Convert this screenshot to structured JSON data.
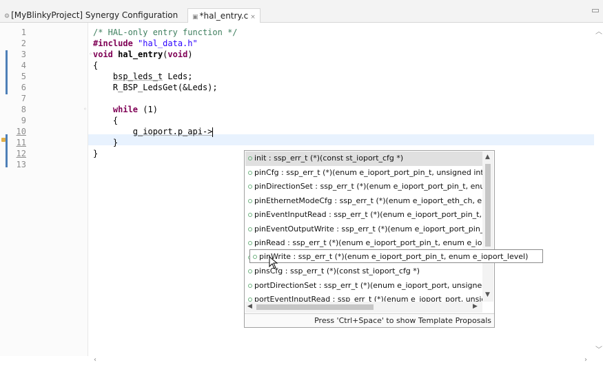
{
  "tabs": [
    {
      "label": "[MyBlinkyProject] Synergy Configuration",
      "icon": "gear-icon"
    },
    {
      "label": "*hal_entry.c",
      "icon": "c-file-icon",
      "close": "×"
    }
  ],
  "editor": {
    "line_numbers": [
      "1",
      "2",
      "3",
      "4",
      "5",
      "6",
      "7",
      "8",
      "9",
      "10",
      "11",
      "12",
      "13"
    ],
    "lines": [
      {
        "parts": [
          {
            "t": "/* HAL-only entry function */",
            "c": "cmt"
          }
        ]
      },
      {
        "parts": [
          {
            "t": "#include",
            "c": "kw"
          },
          {
            "t": " "
          },
          {
            "t": "\"hal_data.h\"",
            "c": "str"
          }
        ]
      },
      {
        "parts": [
          {
            "t": "void",
            "c": "kw"
          },
          {
            "t": " "
          },
          {
            "t": "hal_entry",
            "c": "fn"
          },
          {
            "t": "("
          },
          {
            "t": "void",
            "c": "kw"
          },
          {
            "t": ")"
          }
        ]
      },
      {
        "parts": [
          {
            "t": "{"
          }
        ]
      },
      {
        "parts": [
          {
            "t": "    "
          },
          {
            "t": "bsp_leds_t",
            "c": "ident"
          },
          {
            "t": " Leds;"
          }
        ]
      },
      {
        "parts": [
          {
            "t": "    R_BSP_LedsGet(&Leds);"
          }
        ]
      },
      {
        "parts": []
      },
      {
        "parts": [
          {
            "t": "    "
          },
          {
            "t": "while",
            "c": "kw"
          },
          {
            "t": " (1)"
          }
        ]
      },
      {
        "parts": [
          {
            "t": "    {"
          }
        ]
      },
      {
        "parts": [
          {
            "t": "        "
          },
          {
            "t": "g_ioport.p_api->",
            "c": "ident"
          }
        ]
      },
      {
        "parts": [
          {
            "t": "    }"
          }
        ]
      },
      {
        "parts": [
          {
            "t": "}"
          }
        ]
      },
      {
        "parts": []
      }
    ]
  },
  "autocomplete": {
    "items": [
      "init : ssp_err_t (*)(const st_ioport_cfg *)",
      "pinCfg : ssp_err_t (*)(enum e_ioport_port_pin_t, unsigned int)",
      "pinDirectionSet : ssp_err_t (*)(enum e_ioport_port_pin_t, enum e_ioport_direction)",
      "pinEthernetModeCfg : ssp_err_t (*)(enum e_ioport_eth_ch, enum e_ioport_eth_mode)",
      "pinEventInputRead : ssp_err_t (*)(enum e_ioport_port_pin_t, enum e_ioport_level *)",
      "pinEventOutputWrite : ssp_err_t (*)(enum e_ioport_port_pin_t, enum e_ioport_level)",
      "pinRead : ssp_err_t (*)(enum e_ioport_port_pin_t, enum e_ioport_level *)",
      "pinWrite : ssp_err_t (*)(enum e_ioport_port_pin_t, enum e_ioport_level)",
      "pinsCfg : ssp_err_t (*)(const st_ioport_cfg *)",
      "portDirectionSet : ssp_err_t (*)(enum e_ioport_port, unsigned short, unsigned short)",
      "portEventInputRead : ssp_err_t (*)(enum e_ioport_port, unsigned short *)"
    ],
    "selected_index": 0,
    "status": "Press 'Ctrl+Space' to show Template Proposals",
    "tooltip": "pinWrite : ssp_err_t (*)(enum e_ioport_port_pin_t, enum e_ioport_level)"
  }
}
